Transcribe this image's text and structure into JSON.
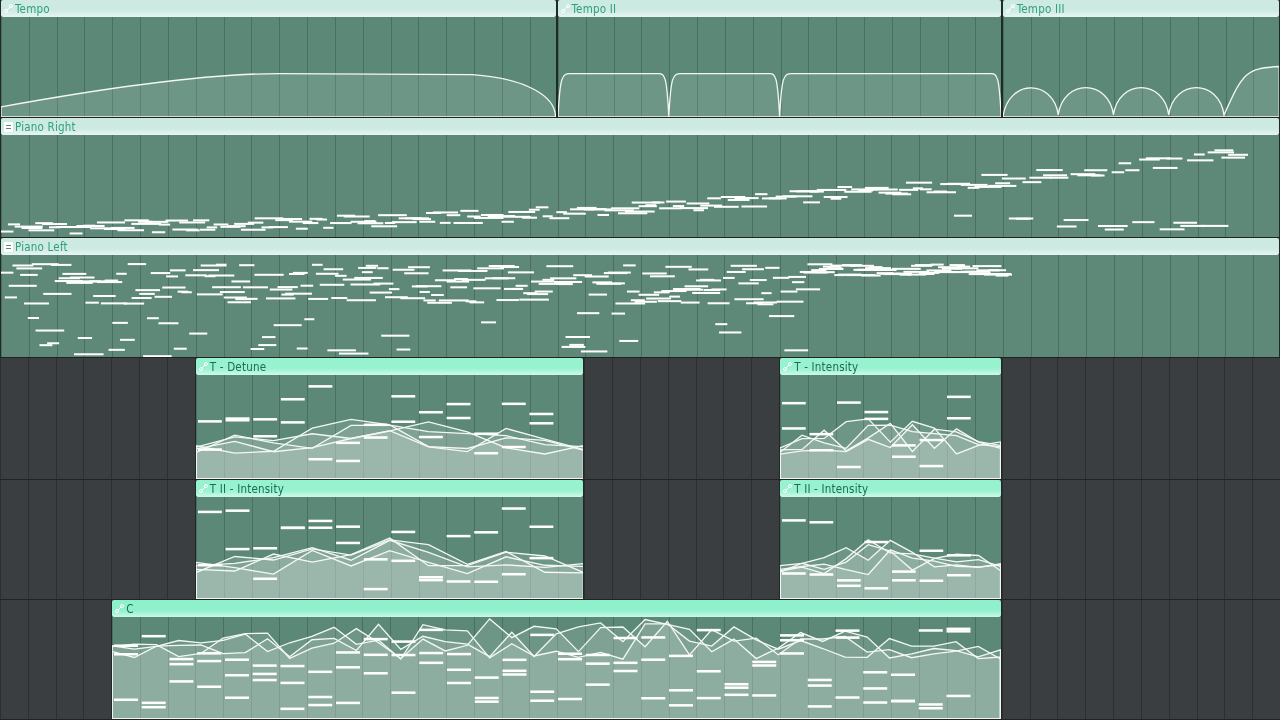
{
  "lanes": [
    {
      "clips": [
        {
          "title": "Tempo",
          "kind": "automation",
          "color": "#cdeae2"
        },
        {
          "title": "Tempo II",
          "kind": "automation",
          "color": "#cdeae2"
        },
        {
          "title": "Tempo III",
          "kind": "automation",
          "color": "#cdeae2"
        }
      ]
    },
    {
      "clips": [
        {
          "title": "Piano Right",
          "kind": "pattern",
          "color": "#cdeae2"
        }
      ]
    },
    {
      "clips": [
        {
          "title": "Piano Left",
          "kind": "pattern",
          "color": "#cdeae2"
        }
      ]
    },
    {
      "clips": [
        {
          "title": "T - Detune",
          "kind": "automation",
          "color": "#97f2d0"
        },
        {
          "title": "T - Intensity",
          "kind": "automation",
          "color": "#97f2d0"
        }
      ]
    },
    {
      "clips": [
        {
          "title": "T II - Intensity",
          "kind": "automation",
          "color": "#97f2d0"
        },
        {
          "title": "T II - Intensity",
          "kind": "automation",
          "color": "#97f2d0"
        }
      ]
    },
    {
      "clips": [
        {
          "title": "C",
          "kind": "automation",
          "color": "#8ff0cc"
        }
      ]
    }
  ]
}
